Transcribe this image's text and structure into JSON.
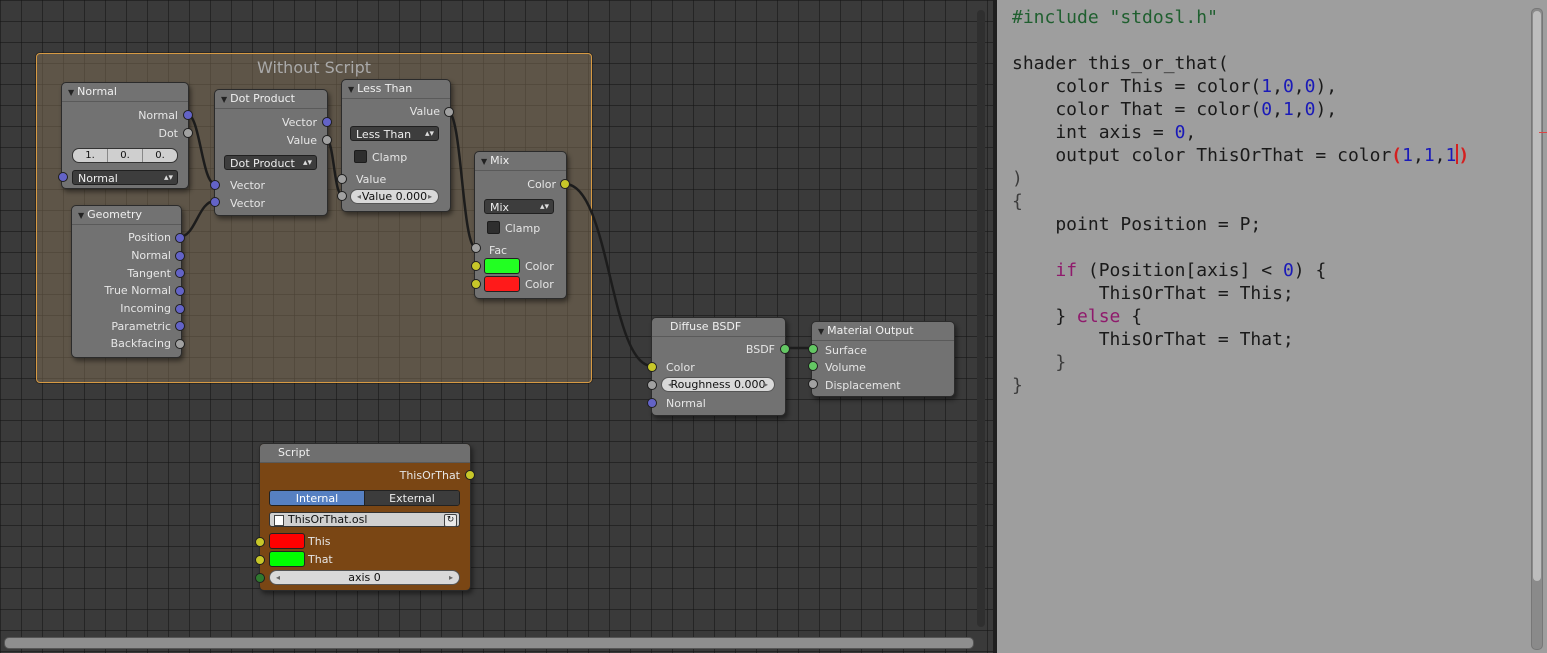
{
  "frame": {
    "title": "Without Script"
  },
  "nodes": {
    "normal": {
      "title": "Normal",
      "outputs": [
        "Normal",
        "Dot"
      ],
      "vector": [
        "1.",
        "0.",
        "0."
      ],
      "input_dropdown": "Normal"
    },
    "geometry": {
      "title": "Geometry",
      "outputs": [
        "Position",
        "Normal",
        "Tangent",
        "True Normal",
        "Incoming",
        "Parametric",
        "Backfacing"
      ]
    },
    "dot_product": {
      "title": "Dot Product",
      "outputs": [
        "Vector",
        "Value"
      ],
      "operation": "Dot Product",
      "inputs": [
        "Vector",
        "Vector"
      ]
    },
    "less_than": {
      "title": "Less Than",
      "output": "Value",
      "operation": "Less Than",
      "clamp_label": "Clamp",
      "input": "Value",
      "field": "Value 0.000"
    },
    "mix": {
      "title": "Mix",
      "output": "Color",
      "blend": "Mix",
      "clamp_label": "Clamp",
      "fac_label": "Fac",
      "color1_label": "Color",
      "color2_label": "Color",
      "color1": "#22ff22",
      "color2": "#ff1a1a"
    },
    "diffuse": {
      "title": "Diffuse BSDF",
      "output": "BSDF",
      "color_label": "Color",
      "roughness": "Roughness 0.000",
      "normal_label": "Normal"
    },
    "material_output": {
      "title": "Material Output",
      "inputs": [
        "Surface",
        "Volume",
        "Displacement"
      ]
    },
    "script": {
      "title": "Script",
      "output": "ThisOrThat",
      "mode_internal": "Internal",
      "mode_external": "External",
      "file": "ThisOrThat.osl",
      "input_this": "This",
      "input_that": "That",
      "axis": "axis 0",
      "this_color": "#ff0000",
      "that_color": "#00ff00"
    }
  },
  "code_lines": [
    "#include \"stdosl.h\"",
    "",
    "shader this_or_that(",
    "    color This = color(1,0,0),",
    "    color That = color(0,1,0),",
    "    int axis = 0,",
    "    output color ThisOrThat = color(1,1,1)",
    ")",
    "{",
    "    point Position = P;",
    "",
    "    if (Position[axis] < 0) {",
    "        ThisOrThat = This;",
    "    } else {",
    "        ThisOrThat = That;",
    "    }",
    "}"
  ],
  "colors": {
    "frame_border": "#d79a43",
    "script_node": "#7a4614",
    "keyword": "#8f1a6c",
    "number": "#1a1ab8",
    "include": "#1f5f2f"
  }
}
